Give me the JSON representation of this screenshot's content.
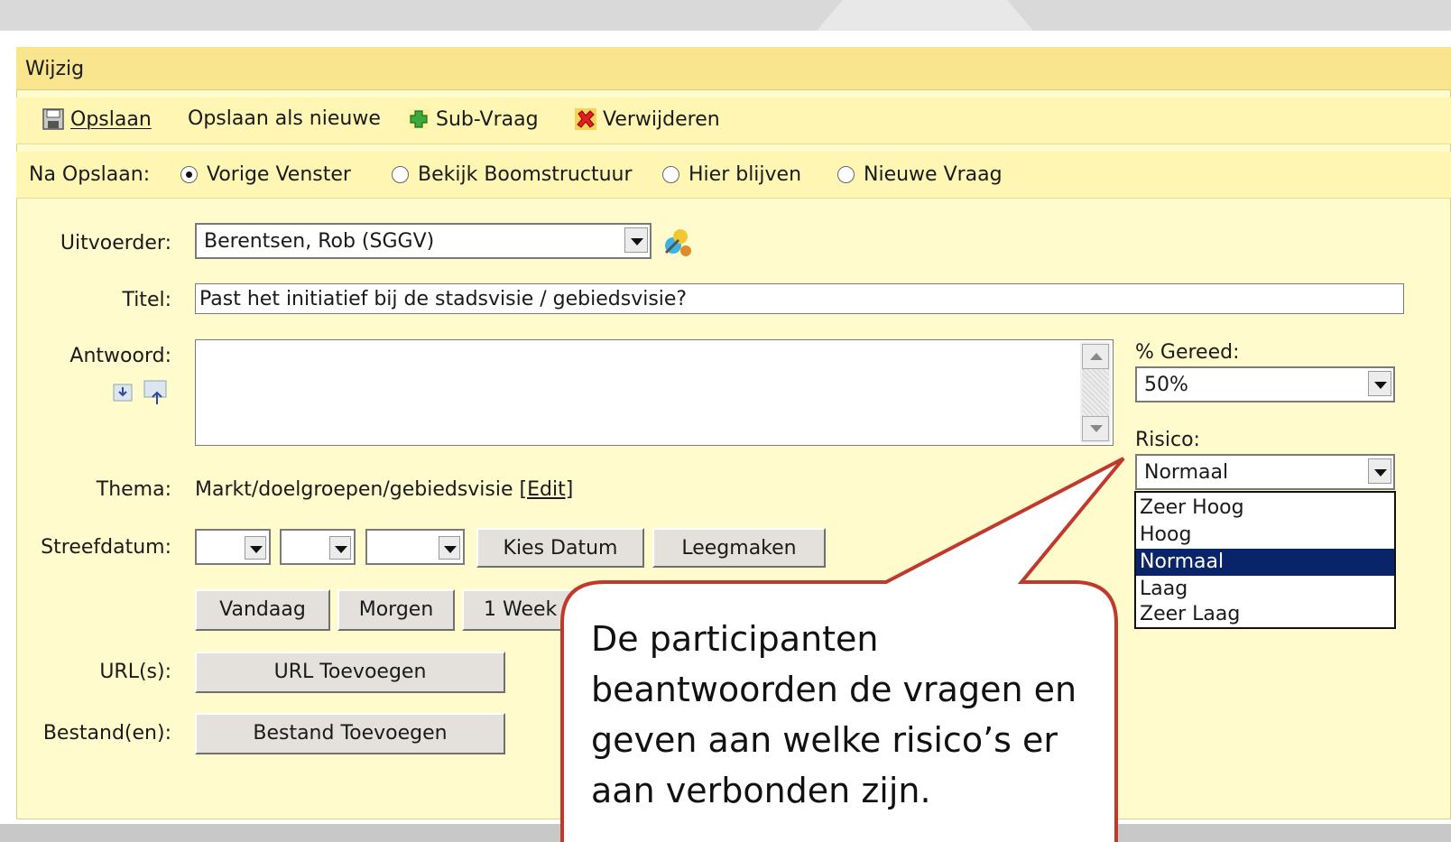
{
  "window": {
    "title": "Wijzig"
  },
  "toolbar": {
    "save": "Opslaan",
    "save_as_new": "Opslaan als nieuwe",
    "sub_question": "Sub-Vraag",
    "delete": "Verwijderen"
  },
  "after_save": {
    "label": "Na Opslaan:",
    "options": [
      "Vorige Venster",
      "Bekijk Boomstructuur",
      "Hier blijven",
      "Nieuwe Vraag"
    ],
    "selected": "Vorige Venster"
  },
  "form": {
    "executor": {
      "label": "Uitvoerder:",
      "value": "Berentsen, Rob (SGGV)"
    },
    "title": {
      "label": "Titel:",
      "value": "Past het initiatief bij de stadsvisie / gebiedsvisie?"
    },
    "answer": {
      "label": "Antwoord:",
      "value": ""
    },
    "theme": {
      "label": "Thema:",
      "value": "Markt/doelgroepen/gebiedsvisie",
      "edit_link": "[Edit]"
    },
    "target_date": {
      "label": "Streefdatum:",
      "pick_date": "Kies Datum",
      "clear": "Leegmaken",
      "today": "Vandaag",
      "tomorrow": "Morgen",
      "one_week": "1 Week"
    },
    "urls": {
      "label": "URL(s):",
      "button": "URL Toevoegen"
    },
    "files": {
      "label": "Bestand(en):",
      "button": "Bestand Toevoegen"
    },
    "percent_done": {
      "label": "% Gereed:",
      "value": "50%"
    },
    "risk": {
      "label": "Risico:",
      "value": "Normaal",
      "options": [
        "Zeer Hoog",
        "Hoog",
        "Normaal",
        "Laag",
        "Zeer Laag"
      ],
      "highlighted": "Normaal"
    }
  },
  "callout": {
    "text": "De participanten beantwoorden de vragen en geven aan welke risico’s er aan verbonden zijn.",
    "border_color": "#c0392b"
  }
}
